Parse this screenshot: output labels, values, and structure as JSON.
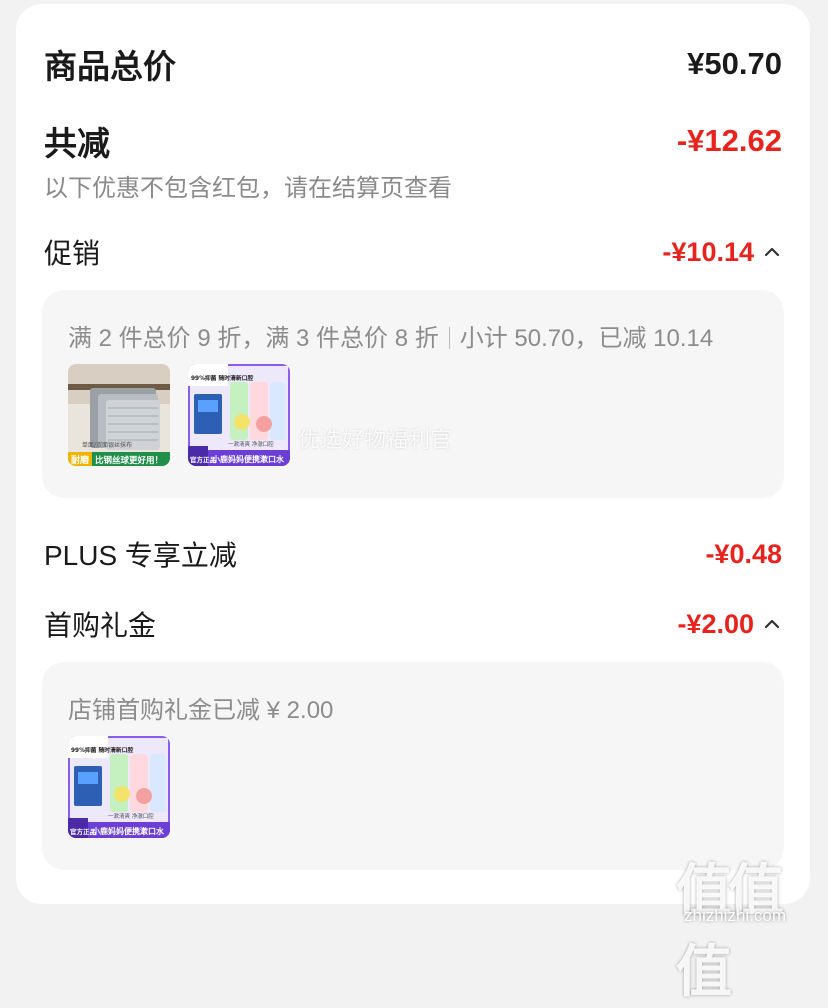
{
  "total": {
    "label": "商品总价",
    "amount": "¥50.70"
  },
  "discount": {
    "label": "共减",
    "amount": "-¥12.62",
    "note": "以下优惠不包含红包，请在结算页查看"
  },
  "promo": {
    "label": "促销",
    "amount": "-¥10.14",
    "expanded": true,
    "rule": "满 2 件总价 9 折，满 3 件总价 8 折",
    "subtotal": "小计 50.70，已减 10.14",
    "products": [
      {
        "top_text": "",
        "bottom_left": "耐磨",
        "bottom_right": "比钢丝球更好用！",
        "sub_text": "单面/双面银丝抹布"
      },
      {
        "top_text": "99%抑菌 随时清新口腔",
        "bottom_left": "官方正品",
        "bottom_right": "小鹿妈妈便携漱口水",
        "sub_text": "一漱清爽 净澈口腔"
      }
    ]
  },
  "plus": {
    "label": "PLUS 专享立减",
    "amount": "-¥0.48"
  },
  "first_purchase": {
    "label": "首购礼金",
    "amount": "-¥2.00",
    "expanded": true,
    "detail": "店铺首购礼金已减 ¥ 2.00",
    "products": [
      {
        "top_text": "99%抑菌 随时清新口腔",
        "bottom_left": "官方正品",
        "bottom_right": "小鹿妈妈便携漱口水",
        "sub_text": "一漱清爽 净澈口腔"
      }
    ]
  },
  "watermark": {
    "overlay_text": "优选好物福利官",
    "logo_text": "值值值",
    "logo_url": "zhizhizhi.com"
  },
  "colors": {
    "red": "#e8231e",
    "text": "#1a1a1a",
    "muted": "#8a8a8a",
    "panel": "#f6f6f7"
  }
}
